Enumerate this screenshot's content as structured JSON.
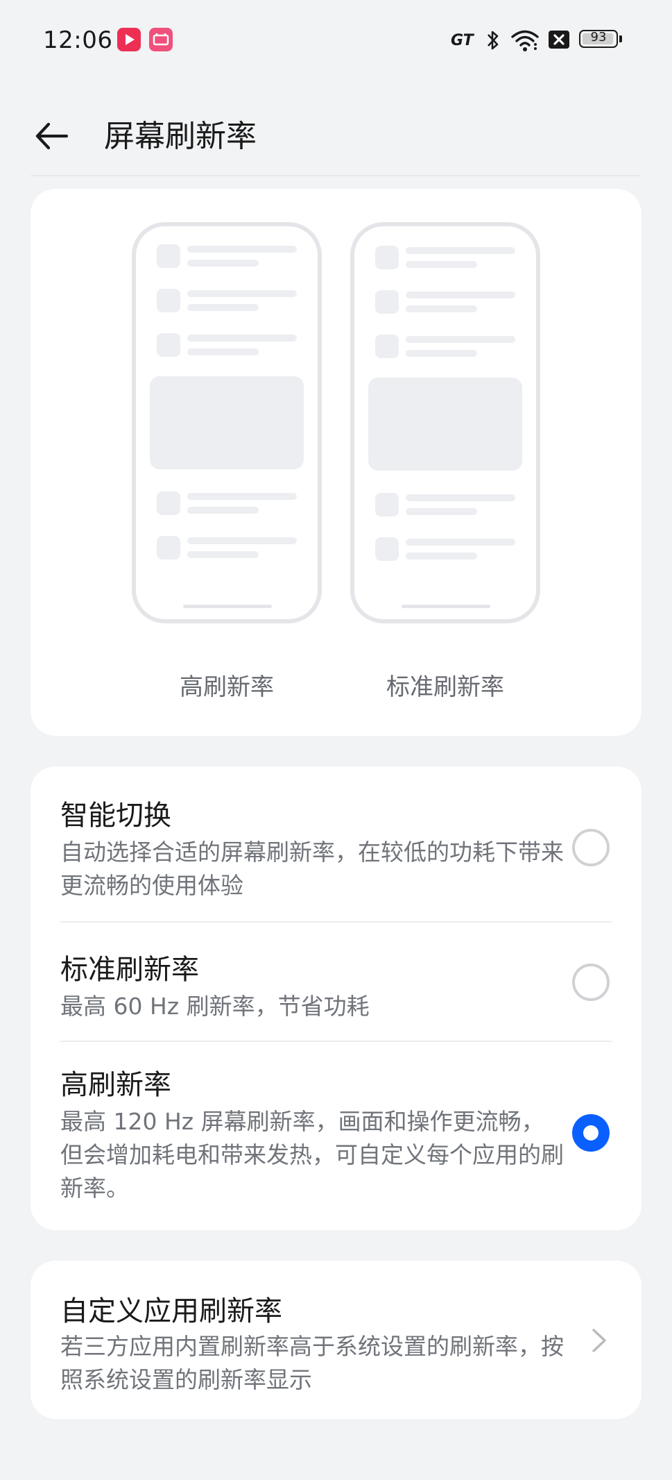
{
  "status_bar": {
    "time": "12:06",
    "icons": [
      "video-app-icon",
      "ticket-app-icon",
      "gt-mode-icon",
      "bluetooth-icon",
      "wifi-icon",
      "close-box-icon",
      "battery-icon"
    ],
    "gt_label": "GT",
    "battery_level": "93"
  },
  "header": {
    "back_icon": "arrow-left-icon",
    "title": "屏幕刷新率"
  },
  "preview": {
    "left_label": "高刷新率",
    "right_label": "标准刷新率"
  },
  "options": [
    {
      "title": "智能切换",
      "description": "自动选择合适的屏幕刷新率，在较低的功耗下带来更流畅的使用体验",
      "selected": false
    },
    {
      "title": "标准刷新率",
      "description": "最高 60 Hz 刷新率，节省功耗",
      "selected": false
    },
    {
      "title": "高刷新率",
      "description": "最高 120 Hz 屏幕刷新率，画面和操作更流畅，但会增加耗电和带来发热，可自定义每个应用的刷新率。",
      "selected": true
    }
  ],
  "custom": {
    "title": "自定义应用刷新率",
    "description": "若三方应用内置刷新率高于系统设置的刷新率，按照系统设置的刷新率显示",
    "icon": "chevron-right-icon"
  },
  "colors": {
    "accent": "#0a5fff",
    "background": "#f2f3f5",
    "card": "#ffffff"
  }
}
